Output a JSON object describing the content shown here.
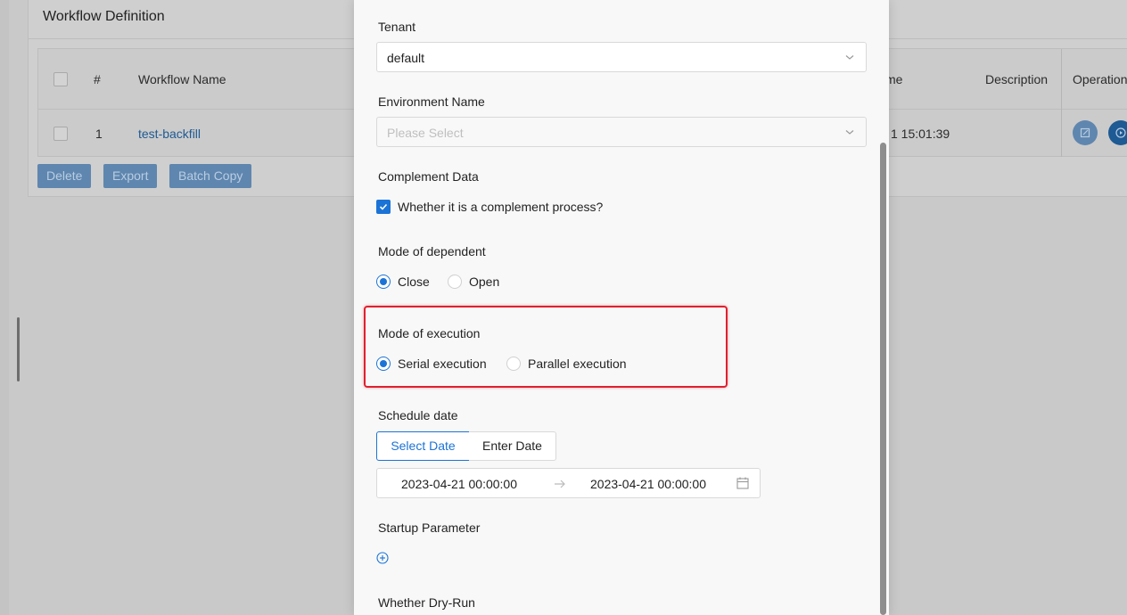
{
  "background": {
    "card_title": "Workflow Definition",
    "table": {
      "headers": [
        "#",
        "Workflow Name",
        "me",
        "Description",
        "Operation"
      ],
      "rows": [
        {
          "index": "1",
          "name": "test-backfill",
          "time": "1 15:01:39"
        }
      ]
    },
    "buttons": {
      "delete": "Delete",
      "export": "Export",
      "batch_copy": "Batch Copy"
    }
  },
  "form": {
    "tenant": {
      "label": "Tenant",
      "value": "default"
    },
    "environment": {
      "label": "Environment Name",
      "placeholder": "Please Select"
    },
    "complement": {
      "label": "Complement Data",
      "checkbox_label": "Whether it is a complement process?",
      "checked": true
    },
    "dependent": {
      "label": "Mode of dependent",
      "options": [
        "Close",
        "Open"
      ],
      "selected": "Close"
    },
    "execution": {
      "label": "Mode of execution",
      "options": [
        "Serial execution",
        "Parallel execution"
      ],
      "selected": "Serial execution"
    },
    "schedule": {
      "label": "Schedule date",
      "tabs": [
        "Select Date",
        "Enter Date"
      ],
      "active_tab": "Select Date",
      "start": "2023-04-21 00:00:00",
      "end": "2023-04-21 00:00:00"
    },
    "startup": {
      "label": "Startup Parameter"
    },
    "dry_run": {
      "label": "Whether Dry-Run"
    }
  },
  "colors": {
    "primary": "#1c73d6",
    "highlight": "#e0202f",
    "overlay": "#c9c9c9"
  }
}
